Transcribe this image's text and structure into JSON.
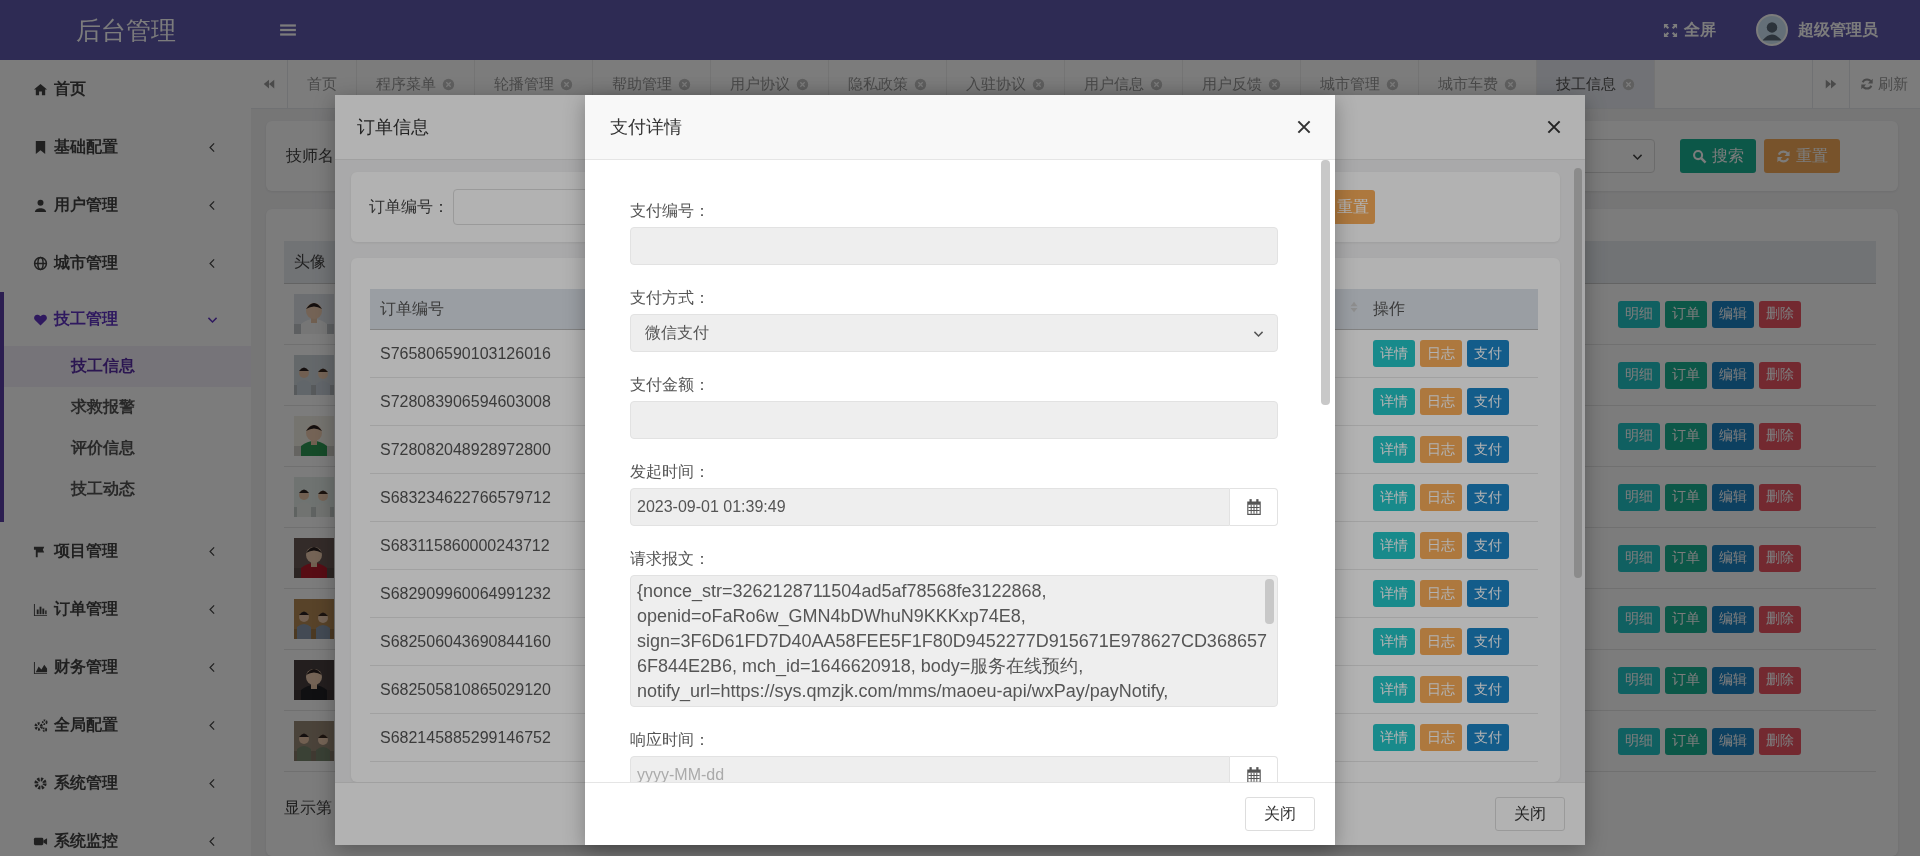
{
  "header": {
    "title": "后台管理",
    "fullscreen": "全屏",
    "user": "超级管理员"
  },
  "sidebar": {
    "items": [
      {
        "label": "首页",
        "kind": "link"
      },
      {
        "label": "基础配置",
        "kind": "group",
        "expanded": false
      },
      {
        "label": "用户管理",
        "kind": "group",
        "expanded": false
      },
      {
        "label": "城市管理",
        "kind": "group",
        "expanded": false
      },
      {
        "label": "技工管理",
        "kind": "group",
        "expanded": true,
        "children": [
          {
            "label": "技工信息",
            "selected": true
          },
          {
            "label": "求救报警",
            "selected": false
          },
          {
            "label": "评价信息",
            "selected": false
          },
          {
            "label": "技工动态",
            "selected": false
          }
        ]
      },
      {
        "label": "项目管理",
        "kind": "group",
        "expanded": false
      },
      {
        "label": "订单管理",
        "kind": "group",
        "expanded": false
      },
      {
        "label": "财务管理",
        "kind": "group",
        "expanded": false
      },
      {
        "label": "全局配置",
        "kind": "group",
        "expanded": false
      },
      {
        "label": "系统管理",
        "kind": "group",
        "expanded": false
      },
      {
        "label": "系统监控",
        "kind": "group",
        "expanded": false
      }
    ]
  },
  "tabs": {
    "items": [
      {
        "label": "首页",
        "closable": false,
        "selected": false
      },
      {
        "label": "程序菜单",
        "closable": true,
        "selected": false
      },
      {
        "label": "轮播管理",
        "closable": true,
        "selected": false
      },
      {
        "label": "帮助管理",
        "closable": true,
        "selected": false
      },
      {
        "label": "用户协议",
        "closable": true,
        "selected": false
      },
      {
        "label": "隐私政策",
        "closable": true,
        "selected": false
      },
      {
        "label": "入驻协议",
        "closable": true,
        "selected": false
      },
      {
        "label": "用户信息",
        "closable": true,
        "selected": false
      },
      {
        "label": "用户反馈",
        "closable": true,
        "selected": false
      },
      {
        "label": "城市管理",
        "closable": true,
        "selected": false
      },
      {
        "label": "城市车费",
        "closable": true,
        "selected": false
      },
      {
        "label": "技工信息",
        "closable": true,
        "selected": true
      }
    ],
    "refresh": "刷新"
  },
  "page": {
    "search": {
      "label": "技师名",
      "search_button": "搜索",
      "reset_button": "重置"
    },
    "table": {
      "columns": [
        "头像"
      ],
      "rows": [
        {
          "actions": [
            {
              "label": "明细",
              "kind": "info"
            },
            {
              "label": "订单",
              "kind": "success"
            },
            {
              "label": "编辑",
              "kind": "primary"
            },
            {
              "label": "删除",
              "kind": "danger"
            }
          ]
        },
        {
          "actions": [
            {
              "label": "明细",
              "kind": "info"
            },
            {
              "label": "订单",
              "kind": "success"
            },
            {
              "label": "编辑",
              "kind": "primary"
            },
            {
              "label": "删除",
              "kind": "danger"
            }
          ]
        },
        {
          "actions": [
            {
              "label": "明细",
              "kind": "info"
            },
            {
              "label": "订单",
              "kind": "success"
            },
            {
              "label": "编辑",
              "kind": "primary"
            },
            {
              "label": "删除",
              "kind": "danger"
            }
          ]
        },
        {
          "actions": [
            {
              "label": "明细",
              "kind": "info"
            },
            {
              "label": "订单",
              "kind": "success"
            },
            {
              "label": "编辑",
              "kind": "primary"
            },
            {
              "label": "删除",
              "kind": "danger"
            }
          ]
        },
        {
          "actions": [
            {
              "label": "明细",
              "kind": "info"
            },
            {
              "label": "订单",
              "kind": "success"
            },
            {
              "label": "编辑",
              "kind": "primary"
            },
            {
              "label": "删除",
              "kind": "danger"
            }
          ]
        },
        {
          "actions": [
            {
              "label": "明细",
              "kind": "info"
            },
            {
              "label": "订单",
              "kind": "success"
            },
            {
              "label": "编辑",
              "kind": "primary"
            },
            {
              "label": "删除",
              "kind": "danger"
            }
          ]
        },
        {
          "actions": [
            {
              "label": "明细",
              "kind": "info"
            },
            {
              "label": "订单",
              "kind": "success"
            },
            {
              "label": "编辑",
              "kind": "primary"
            },
            {
              "label": "删除",
              "kind": "danger"
            }
          ]
        },
        {
          "actions": [
            {
              "label": "明细",
              "kind": "info"
            },
            {
              "label": "订单",
              "kind": "success"
            },
            {
              "label": "编辑",
              "kind": "primary"
            },
            {
              "label": "删除",
              "kind": "danger"
            }
          ]
        }
      ]
    },
    "footer_text": "显示第"
  },
  "order_dialog": {
    "title": "订单信息",
    "search": {
      "label": "订单编号：",
      "reset_button": "重置"
    },
    "table": {
      "columns": [
        "订单编号",
        "操作"
      ],
      "rows": [
        {
          "order_no": "S765806590103126016",
          "actions": [
            {
              "label": "详情",
              "kind": "info"
            },
            {
              "label": "日志",
              "kind": "warning"
            },
            {
              "label": "支付",
              "kind": "primary"
            }
          ]
        },
        {
          "order_no": "S728083906594603008",
          "actions": [
            {
              "label": "详情",
              "kind": "info"
            },
            {
              "label": "日志",
              "kind": "warning"
            },
            {
              "label": "支付",
              "kind": "primary"
            }
          ]
        },
        {
          "order_no": "S728082048928972800",
          "actions": [
            {
              "label": "详情",
              "kind": "info"
            },
            {
              "label": "日志",
              "kind": "warning"
            },
            {
              "label": "支付",
              "kind": "primary"
            }
          ]
        },
        {
          "order_no": "S683234622766579712",
          "actions": [
            {
              "label": "详情",
              "kind": "info"
            },
            {
              "label": "日志",
              "kind": "warning"
            },
            {
              "label": "支付",
              "kind": "primary"
            }
          ]
        },
        {
          "order_no": "S683115860000243712",
          "actions": [
            {
              "label": "详情",
              "kind": "info"
            },
            {
              "label": "日志",
              "kind": "warning"
            },
            {
              "label": "支付",
              "kind": "primary"
            }
          ]
        },
        {
          "order_no": "S682909960064991232",
          "actions": [
            {
              "label": "详情",
              "kind": "info"
            },
            {
              "label": "日志",
              "kind": "warning"
            },
            {
              "label": "支付",
              "kind": "primary"
            }
          ]
        },
        {
          "order_no": "S682506043690844160",
          "actions": [
            {
              "label": "详情",
              "kind": "info"
            },
            {
              "label": "日志",
              "kind": "warning"
            },
            {
              "label": "支付",
              "kind": "primary"
            }
          ]
        },
        {
          "order_no": "S682505810865029120",
          "actions": [
            {
              "label": "详情",
              "kind": "info"
            },
            {
              "label": "日志",
              "kind": "warning"
            },
            {
              "label": "支付",
              "kind": "primary"
            }
          ]
        },
        {
          "order_no": "S682145885299146752",
          "actions": [
            {
              "label": "详情",
              "kind": "info"
            },
            {
              "label": "日志",
              "kind": "warning"
            },
            {
              "label": "支付",
              "kind": "primary"
            }
          ]
        }
      ]
    },
    "close_button": "关闭"
  },
  "payment_dialog": {
    "title": "支付详情",
    "fields": [
      {
        "kind": "input",
        "label": "支付编号："
      },
      {
        "kind": "select",
        "label": "支付方式：",
        "value": "微信支付"
      },
      {
        "kind": "input",
        "label": "支付金额："
      },
      {
        "kind": "date",
        "label": "发起时间：",
        "value": "2023-09-01 01:39:49"
      },
      {
        "kind": "textarea",
        "label": "请求报文：",
        "value": "{nonce_str=3262128711504ad5af78568fe3122868, openid=oFaRo6w_GMN4bDWhuN9KKKxp74E8, sign=3F6D61FD7D40AA58FEE5F1F80D9452277D915671E978627CD3686576F844E2B6, mch_id=1646620918, body=服务在线预约, notify_url=https://sys.qmzjk.com/mms/maoeu-api/wxPay/payNotify,"
      },
      {
        "kind": "date",
        "label": "响应时间：",
        "placeholder": "yyyy-MM-dd"
      }
    ],
    "close_button": "关闭"
  }
}
